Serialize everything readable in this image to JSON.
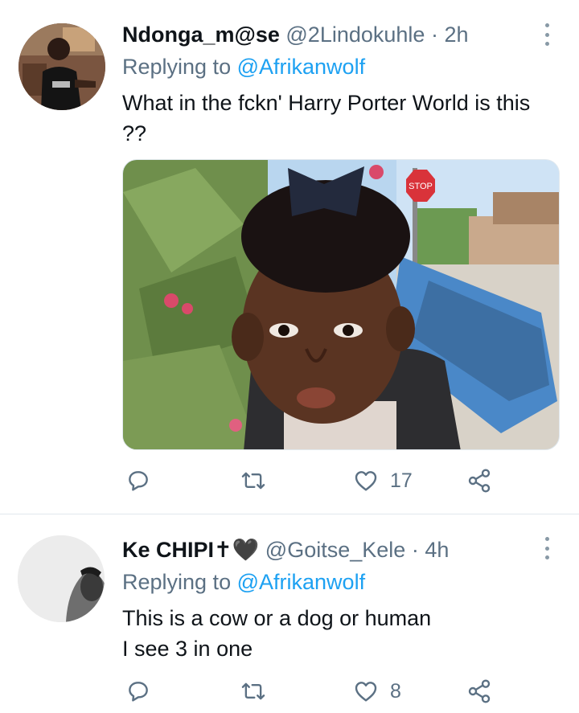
{
  "tweets": [
    {
      "display_name": "Ndonga_m@se",
      "handle": "@2Lindokuhle",
      "separator": "·",
      "time": "2h",
      "replying_prefix": "Replying to",
      "replying_to": "@Afrikanwolf",
      "text": "What in the fckn' Harry Porter World is this ??",
      "media_sign_text": "STOP",
      "actions": {
        "reply_count": "",
        "retweet_count": "",
        "like_count": "17"
      }
    },
    {
      "display_name": "Ke CHIPI✝🖤",
      "handle": "@Goitse_Kele",
      "separator": "·",
      "time": "4h",
      "replying_prefix": "Replying to",
      "replying_to": "@Afrikanwolf",
      "text_lines": [
        "This is a cow or a dog or human",
        "I see 3 in one"
      ],
      "actions": {
        "reply_count": "",
        "retweet_count": "",
        "like_count": "8"
      }
    }
  ],
  "colors": {
    "link": "#1da1f2",
    "secondary_text": "#5b7083",
    "primary_text": "#0f1419",
    "divider": "#e1e8ed"
  },
  "icons": [
    "reply-icon",
    "retweet-icon",
    "like-icon",
    "share-icon",
    "more-icon"
  ]
}
